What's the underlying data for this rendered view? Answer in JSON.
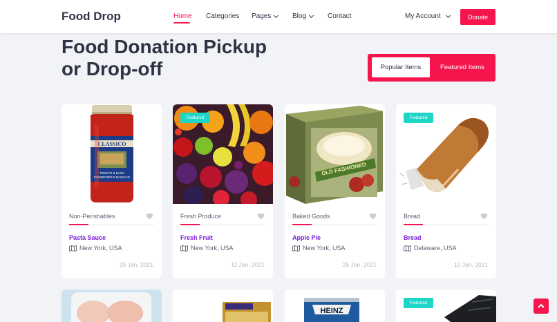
{
  "brand": "Food Drop",
  "nav": {
    "home": "Home",
    "categories": "Categories",
    "pages": "Pages",
    "blog": "Blog",
    "contact": "Contact",
    "account": "My Account",
    "donate": "Donate"
  },
  "page_title": "Food Donation Pickup or Drop-off",
  "toggle": {
    "popular": "Popular Items",
    "featured": "Featured Items"
  },
  "cards": [
    {
      "category": "Non-Perishables",
      "name": "Pasta Sauce",
      "location": "New York, USA",
      "date": "25 Jan, 2021",
      "badge": ""
    },
    {
      "category": "Fresh Produce",
      "name": "Fresh Fruit",
      "location": "New York, USA",
      "date": "12 Jan, 2021",
      "badge": "Featured"
    },
    {
      "category": "Baked Goods",
      "name": "Apple Pie",
      "location": "New York, USA",
      "date": "25 Jan, 2021",
      "badge": ""
    },
    {
      "category": "Bread",
      "name": "Bread",
      "location": "Delaware, USA",
      "date": "10 Jun, 2021",
      "badge": "Featured"
    }
  ],
  "row2_badge": "Featured",
  "colors": {
    "accent": "#f6154d",
    "badge": "#1fd5c8",
    "item_name": "#7a1fd6",
    "heading": "#2e3444"
  }
}
